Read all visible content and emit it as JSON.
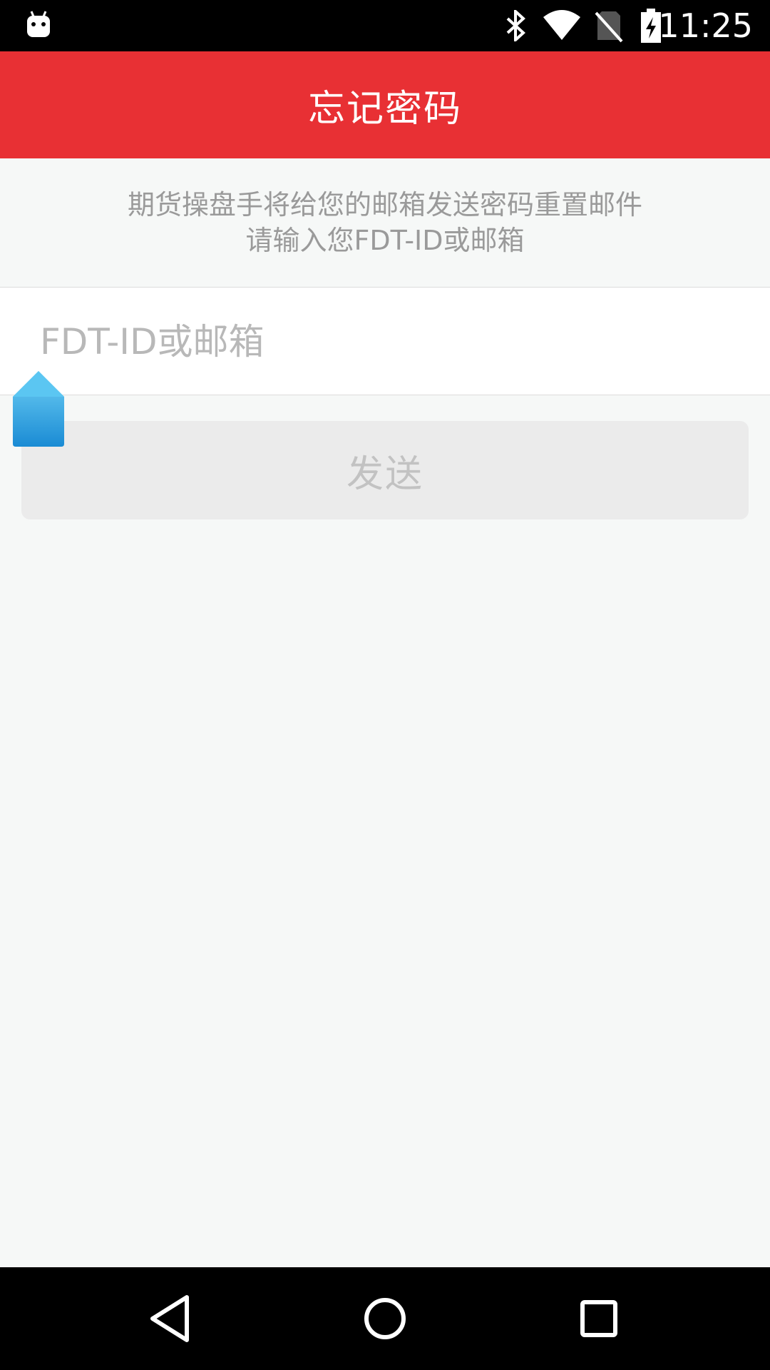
{
  "status_bar": {
    "time": "11:25",
    "icons": [
      "android-robot-icon",
      "bluetooth-icon",
      "wifi-icon",
      "no-sim-icon",
      "battery-charging-icon"
    ]
  },
  "app_bar": {
    "title": "忘记密码"
  },
  "hint": {
    "line1": "期货操盘手将给您的邮箱发送密码重置邮件",
    "line2": "请输入您FDT-ID或邮箱"
  },
  "form": {
    "id_input": {
      "placeholder": "FDT-ID或邮箱",
      "value": ""
    },
    "send_label": "发送"
  },
  "nav_bar": {
    "icons": [
      "back-icon",
      "home-icon",
      "recents-icon"
    ]
  },
  "colors": {
    "accent": "#e83034",
    "background": "#f6f8f7",
    "handle": "#1e8fd6"
  }
}
